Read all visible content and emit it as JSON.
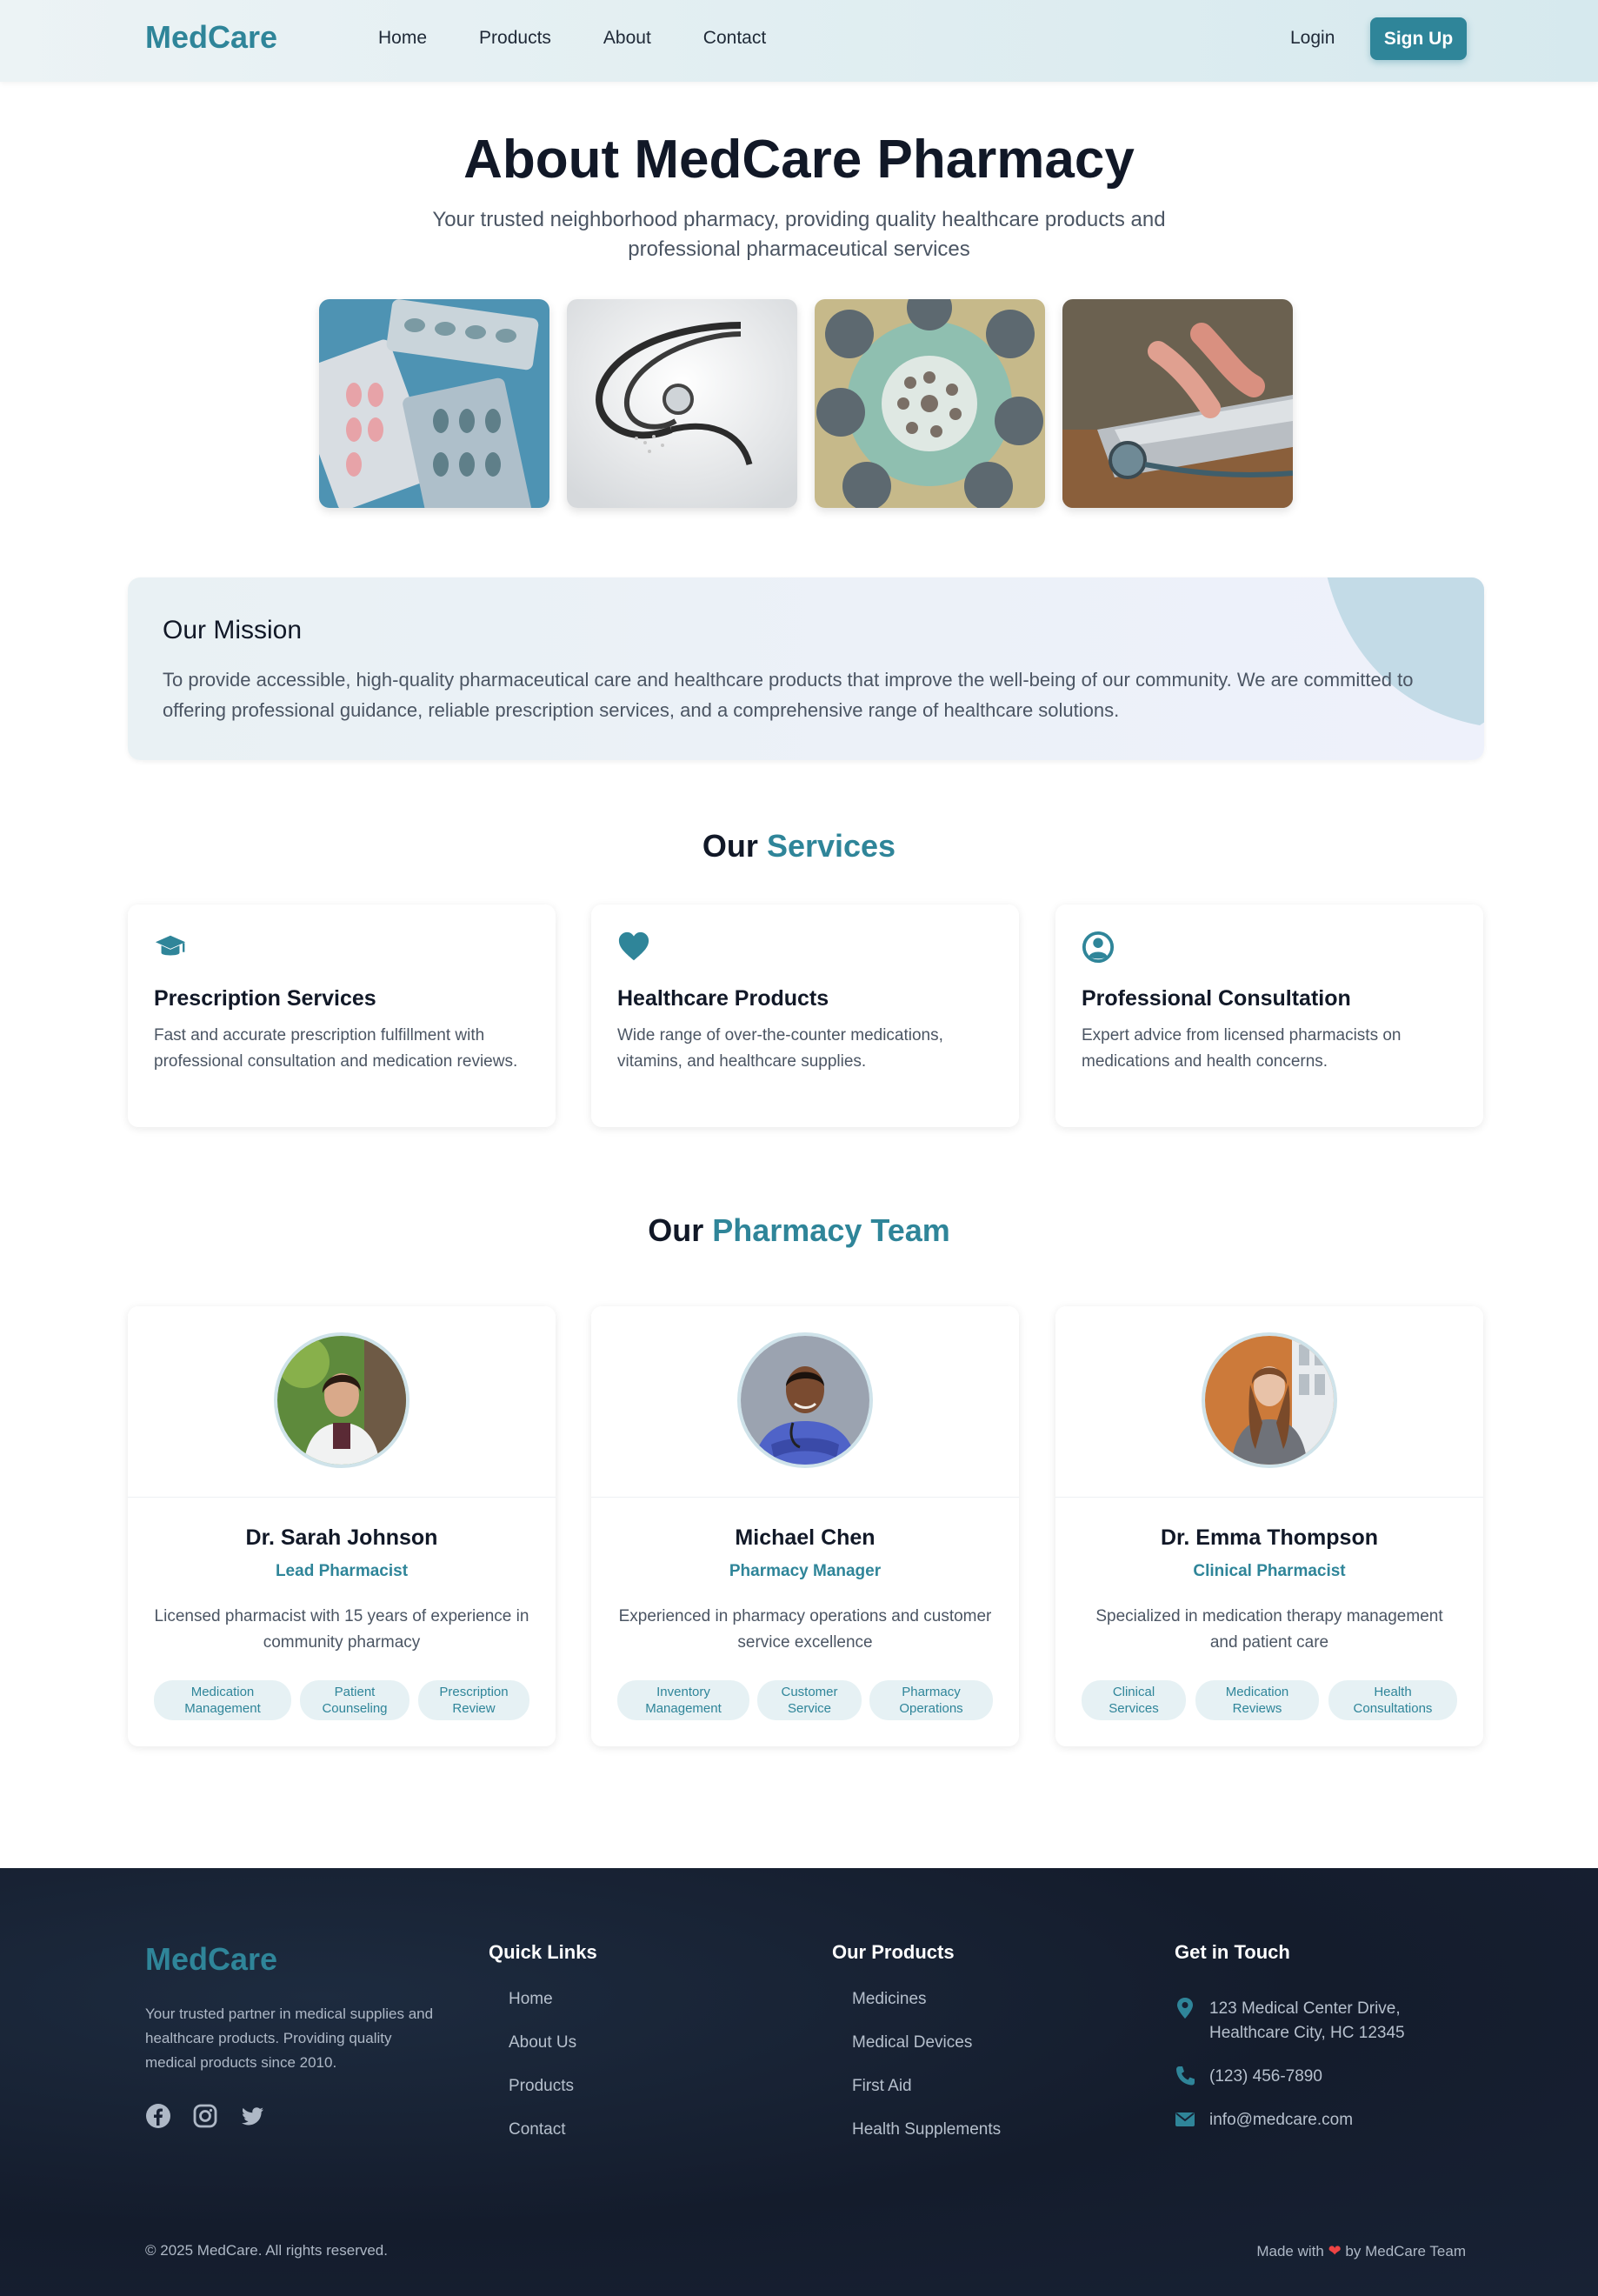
{
  "nav": {
    "logo": "MedCare",
    "links": [
      "Home",
      "Products",
      "About",
      "Contact"
    ],
    "login": "Login",
    "signup": "Sign Up"
  },
  "hero": {
    "title": "About MedCare Pharmacy",
    "subtitle": "Your trusted neighborhood pharmacy, providing quality healthcare products and professional pharmaceutical services"
  },
  "photos": [
    "pills-blister-photo",
    "stethoscope-photo",
    "surgeons-overhead-photo",
    "laptop-stethoscope-photo"
  ],
  "mission": {
    "title": "Our Mission",
    "text": "To provide accessible, high-quality pharmaceutical care and healthcare products that improve the well-being of our community. We are committed to offering professional guidance, reliable prescription services, and a comprehensive range of healthcare solutions."
  },
  "services": {
    "title_prefix": "Our",
    "title_accent": "Services",
    "items": [
      {
        "icon": "graduation-cap-icon",
        "title": "Prescription Services",
        "text": "Fast and accurate prescription fulfillment with professional consultation and medication reviews."
      },
      {
        "icon": "heart-icon",
        "title": "Healthcare Products",
        "text": "Wide range of over-the-counter medications, vitamins, and healthcare supplies."
      },
      {
        "icon": "user-circle-icon",
        "title": "Professional Consultation",
        "text": "Expert advice from licensed pharmacists on medications and health concerns."
      }
    ]
  },
  "team": {
    "title_prefix": "Our",
    "title_accent": "Pharmacy Team",
    "members": [
      {
        "name": "Dr. Sarah Johnson",
        "role": "Lead Pharmacist",
        "bio": "Licensed pharmacist with 15 years of experience in community pharmacy",
        "tags": [
          "Medication Management",
          "Patient Counseling",
          "Prescription Review"
        ]
      },
      {
        "name": "Michael Chen",
        "role": "Pharmacy Manager",
        "bio": "Experienced in pharmacy operations and customer service excellence",
        "tags": [
          "Inventory Management",
          "Customer Service",
          "Pharmacy Operations"
        ]
      },
      {
        "name": "Dr. Emma Thompson",
        "role": "Clinical Pharmacist",
        "bio": "Specialized in medication therapy management and patient care",
        "tags": [
          "Clinical Services",
          "Medication Reviews",
          "Health Consultations"
        ]
      }
    ]
  },
  "footer": {
    "logo": "MedCare",
    "description": "Your trusted partner in medical supplies and healthcare products. Providing quality medical products since 2010.",
    "quick_links": {
      "title": "Quick Links",
      "items": [
        "Home",
        "About Us",
        "Products",
        "Contact"
      ]
    },
    "products": {
      "title": "Our Products",
      "items": [
        "Medicines",
        "Medical Devices",
        "First Aid",
        "Health Supplements"
      ]
    },
    "contact": {
      "title": "Get in Touch",
      "address": "123 Medical Center Drive, Healthcare City, HC 12345",
      "phone": "(123) 456-7890",
      "email": "info@medcare.com"
    },
    "copyright": "© 2025 MedCare. All rights reserved.",
    "made_prefix": "Made with",
    "made_suffix": "by MedCare Team"
  },
  "colors": {
    "accent": "#2f8599",
    "footer_bg": "#141c2c",
    "heart": "#ef4444"
  }
}
